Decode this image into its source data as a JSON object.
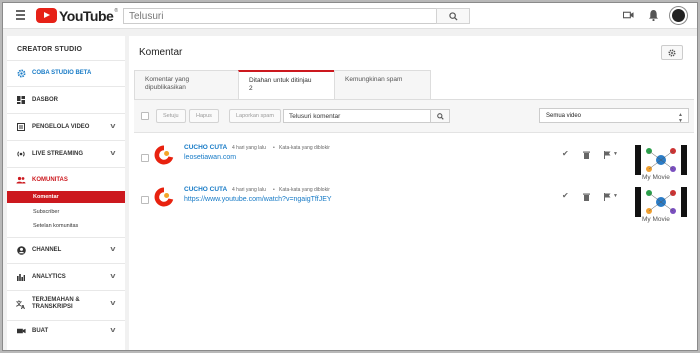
{
  "topbar": {
    "brand": "YouTube",
    "brand_mark": "®",
    "search_placeholder": "Telusuri"
  },
  "sidebar": {
    "studio_title": "CREATOR STUDIO",
    "items": [
      {
        "label": "COBA STUDIO BETA",
        "icon": "gear-icon"
      },
      {
        "label": "DASBOR",
        "icon": "dashboard-icon"
      },
      {
        "label": "PENGELOLA VIDEO",
        "icon": "video-manager-icon"
      },
      {
        "label": "LIVE STREAMING",
        "icon": "live-icon"
      },
      {
        "label": "KOMUNITAS",
        "icon": "people-icon"
      },
      {
        "label": "CHANNEL",
        "icon": "person-icon"
      },
      {
        "label": "ANALYTICS",
        "icon": "bar-chart-icon"
      },
      {
        "label": "TERJEMAHAN & TRANSKRIPSI",
        "icon": "translate-icon"
      },
      {
        "label": "BUAT",
        "icon": "camera-icon"
      }
    ],
    "subitems": [
      "Komentar",
      "Subscriber",
      "Setelan komunitas"
    ]
  },
  "main": {
    "title": "Komentar",
    "tabs": [
      {
        "label": "Komentar yang dipublikasikan"
      },
      {
        "label": "Ditahan untuk ditinjau",
        "count": "2"
      },
      {
        "label": "Kemungkinan spam"
      }
    ],
    "toolbar": {
      "approve": "Setuju",
      "delete": "Hapus",
      "report_spam": "Laporkan spam",
      "search_value": "Telusuri komentar",
      "filter_value": "Semua video"
    },
    "comments": [
      {
        "author": "CUCHO CUTA",
        "time": "4 hari yang lalu",
        "status": "Kata-kata yang diblokir",
        "text": "leosetiawan.com",
        "video": "My Movie"
      },
      {
        "author": "CUCHO CUTA",
        "time": "4 hari yang lalu",
        "status": "Kata-kata yang diblokir",
        "text": "https://www.youtube.com/watch?v=ngaigTffJEY",
        "video": "My Movie"
      }
    ]
  },
  "colors": {
    "accent_red": "#cc181e",
    "link_blue": "#167ac6"
  }
}
